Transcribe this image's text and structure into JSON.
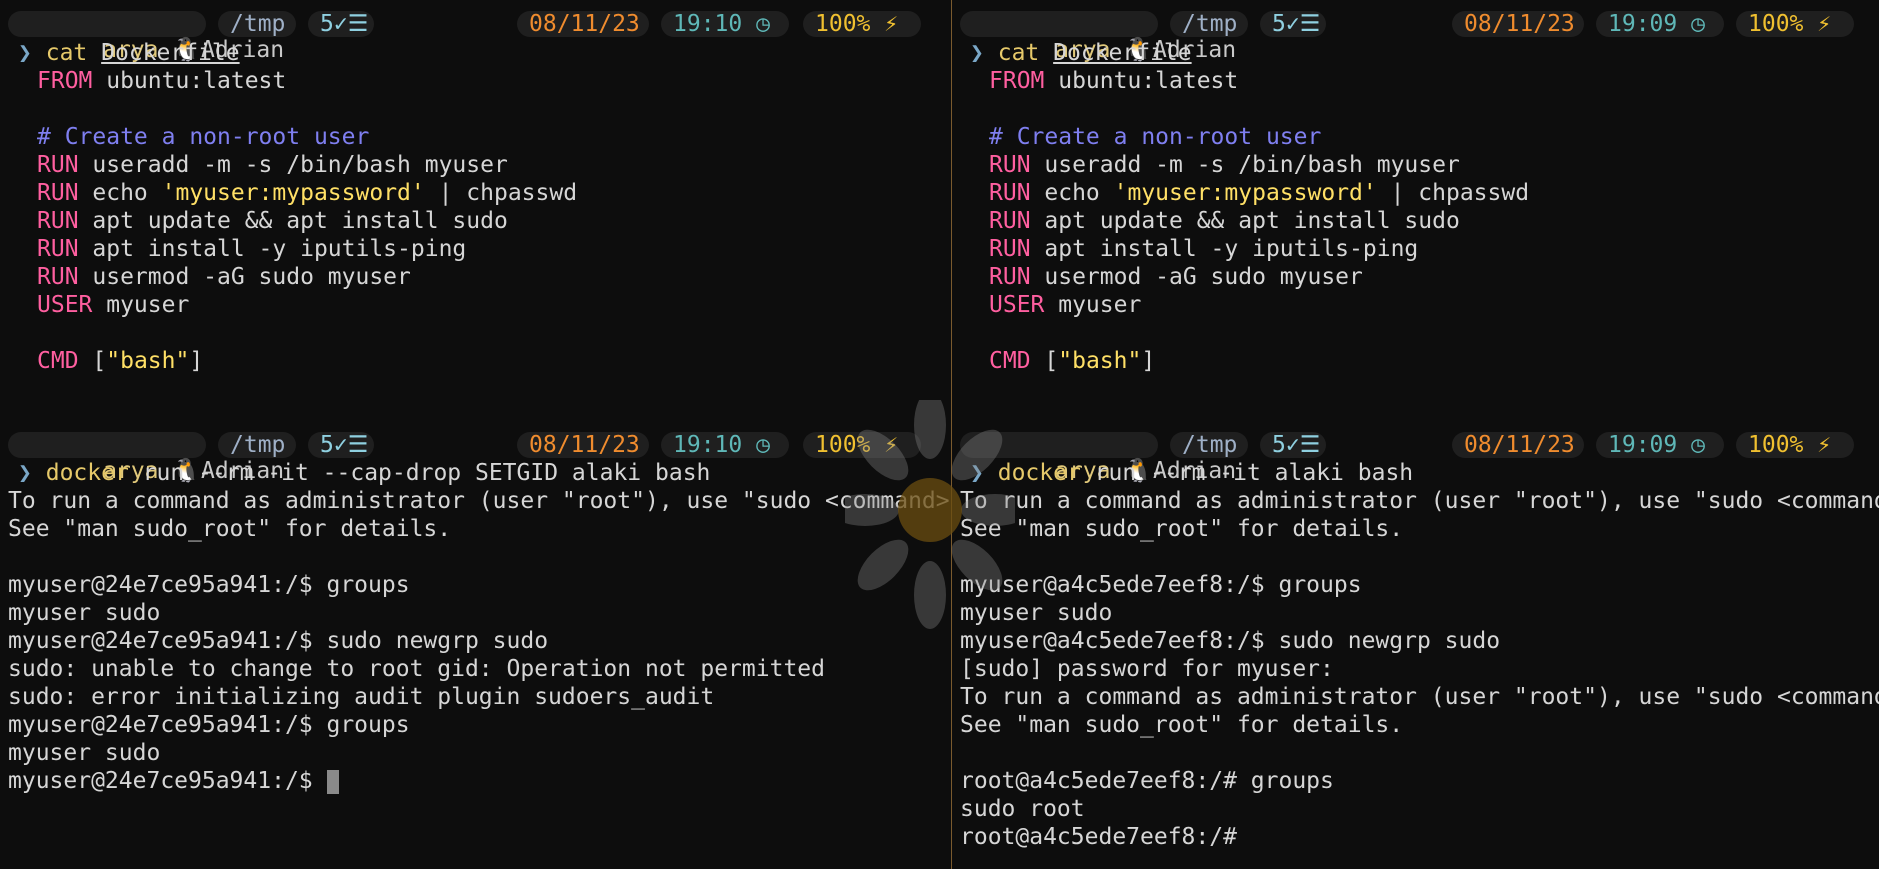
{
  "left": {
    "status_top": {
      "user": "arya",
      "tux_icon": "tux-icon",
      "name": "Adrian",
      "dir": "/tmp",
      "jobs": "5",
      "date": "08/11/23",
      "time": "19:10",
      "battery": "100%"
    },
    "prompt_cat": {
      "arrow": "❯",
      "cmd": "cat",
      "arg": "Dockerfile"
    },
    "dockerfile": [
      {
        "kw": "FROM",
        "rest": " ubuntu:latest"
      },
      {
        "kw": "",
        "rest": ""
      },
      {
        "comment": "# Create a non-root user"
      },
      {
        "kw": "RUN",
        "rest": " useradd -m -s /bin/bash myuser"
      },
      {
        "kw": "RUN",
        "rest": " echo ",
        "str": "'myuser:mypassword'",
        "rest2": " | chpasswd"
      },
      {
        "kw": "RUN",
        "rest": " apt update && apt install sudo"
      },
      {
        "kw": "RUN",
        "rest": " apt install -y iputils-ping"
      },
      {
        "kw": "RUN",
        "rest": " usermod -aG sudo myuser"
      },
      {
        "kw": "USER",
        "rest": " myuser"
      },
      {
        "kw": "",
        "rest": ""
      },
      {
        "kw": "CMD",
        "rest": " [",
        "str": "\"bash\"",
        "rest2": "]"
      }
    ],
    "status_bottom": {
      "user": "arya",
      "name": "Adrian",
      "dir": "/tmp",
      "jobs": "5",
      "date": "08/11/23",
      "time": "19:10",
      "battery": "100%"
    },
    "prompt_docker": {
      "arrow": "❯",
      "cmd": "docker",
      "args": " run --rm -it --cap-drop SETGID alaki bash"
    },
    "output": [
      "To run a command as administrator (user \"root\"), use \"sudo <command>\".",
      "See \"man sudo_root\" for details.",
      "",
      "myuser@24e7ce95a941:/$ groups",
      "myuser sudo",
      "myuser@24e7ce95a941:/$ sudo newgrp sudo",
      "sudo: unable to change to root gid: Operation not permitted",
      "sudo: error initializing audit plugin sudoers_audit",
      "myuser@24e7ce95a941:/$ groups",
      "myuser sudo",
      "myuser@24e7ce95a941:/$ "
    ]
  },
  "right": {
    "status_top": {
      "user": "arya",
      "name": "Adrian",
      "dir": "/tmp",
      "jobs": "5",
      "date": "08/11/23",
      "time": "19:09",
      "battery": "100%"
    },
    "prompt_cat": {
      "arrow": "❯",
      "cmd": "cat",
      "arg": "Dockerfile"
    },
    "dockerfile": [
      {
        "kw": "FROM",
        "rest": " ubuntu:latest"
      },
      {
        "kw": "",
        "rest": ""
      },
      {
        "comment": "# Create a non-root user"
      },
      {
        "kw": "RUN",
        "rest": " useradd -m -s /bin/bash myuser"
      },
      {
        "kw": "RUN",
        "rest": " echo ",
        "str": "'myuser:mypassword'",
        "rest2": " | chpasswd"
      },
      {
        "kw": "RUN",
        "rest": " apt update && apt install sudo"
      },
      {
        "kw": "RUN",
        "rest": " apt install -y iputils-ping"
      },
      {
        "kw": "RUN",
        "rest": " usermod -aG sudo myuser"
      },
      {
        "kw": "USER",
        "rest": " myuser"
      },
      {
        "kw": "",
        "rest": ""
      },
      {
        "kw": "CMD",
        "rest": " [",
        "str": "\"bash\"",
        "rest2": "]"
      }
    ],
    "status_bottom": {
      "user": "arya",
      "name": "Adrian",
      "dir": "/tmp",
      "jobs": "5",
      "date": "08/11/23",
      "time": "19:09",
      "battery": "100%"
    },
    "prompt_docker": {
      "arrow": "❯",
      "cmd": "docker",
      "args": " run --rm -it alaki bash"
    },
    "output": [
      "To run a command as administrator (user \"root\"), use \"sudo <command>\".",
      "See \"man sudo_root\" for details.",
      "",
      "myuser@a4c5ede7eef8:/$ groups",
      "myuser sudo",
      "myuser@a4c5ede7eef8:/$ sudo newgrp sudo",
      "[sudo] password for myuser:",
      "To run a command as administrator (user \"root\"), use \"sudo <command>\".",
      "See \"man sudo_root\" for details.",
      "",
      "root@a4c5ede7eef8:/# groups",
      "sudo root",
      "root@a4c5ede7eef8:/#"
    ]
  },
  "colors": {
    "accent_date": "#f08c2e",
    "accent_time": "#5fb8b8",
    "keyword": "#ff5fa0",
    "string": "#ffe066",
    "comment": "#7f7ff0"
  }
}
